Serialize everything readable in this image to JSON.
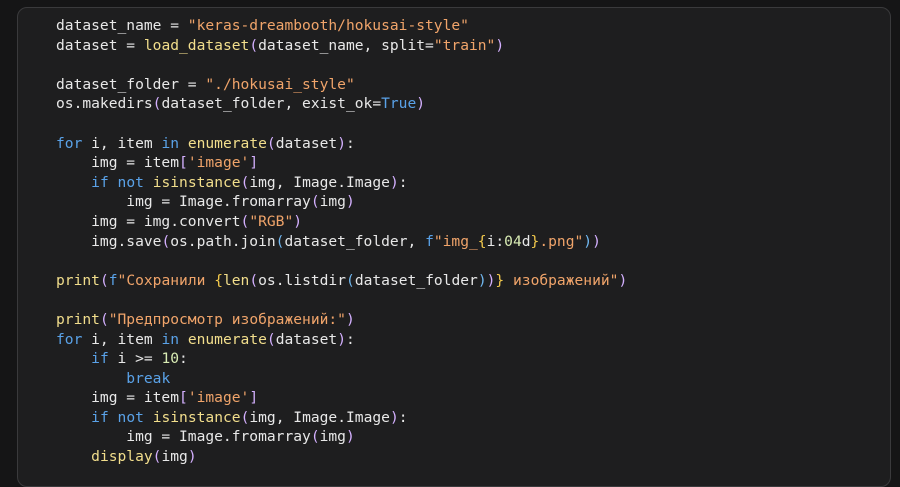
{
  "code_lines": [
    "dataset_name = \"keras-dreambooth/hokusai-style\"",
    "dataset = load_dataset(dataset_name, split=\"train\")",
    "",
    "dataset_folder = \"./hokusai_style\"",
    "os.makedirs(dataset_folder, exist_ok=True)",
    "",
    "for i, item in enumerate(dataset):",
    "    img = item['image']",
    "    if not isinstance(img, Image.Image):",
    "        img = Image.fromarray(img)",
    "    img = img.convert(\"RGB\")",
    "    img.save(os.path.join(dataset_folder, f\"img_{i:04d}.png\"))",
    "",
    "print(f\"Сохранили {len(os.listdir(dataset_folder))} изображений\")",
    "",
    "print(\"Предпросмотр изображений:\")",
    "for i, item in enumerate(dataset):",
    "    if i >= 10:",
    "        break",
    "    img = item['image']",
    "    if not isinstance(img, Image.Image):",
    "        img = Image.fromarray(img)",
    "    display(img)"
  ],
  "colors": {
    "background": "#1e1e1f",
    "text": "#e8e8e8",
    "keyword": "#5aa2e8",
    "function": "#f2de8c",
    "string": "#f0a46a",
    "number": "#d9ecb4",
    "bracket_level_1": "#d4b0ff",
    "bracket_level_2": "#71b8f0",
    "bracket_level_3": "#f2c94c"
  }
}
